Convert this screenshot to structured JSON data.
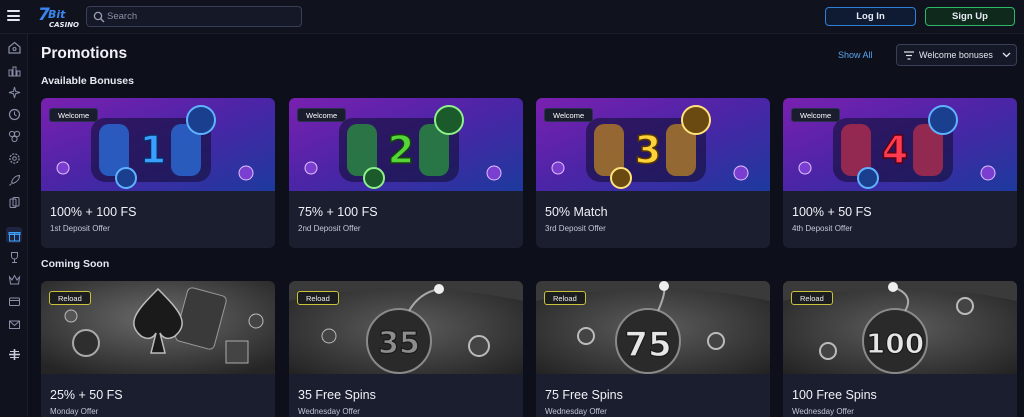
{
  "header": {
    "search_placeholder": "Search",
    "login_label": "Log In",
    "signup_label": "Sign Up",
    "logo_text": "7Bit CASINO"
  },
  "sidebar": {
    "items": [
      {
        "icon": "home-icon"
      },
      {
        "icon": "trophy-stats-icon"
      },
      {
        "icon": "sparkle-icon"
      },
      {
        "icon": "clock-icon"
      },
      {
        "icon": "dice-icon"
      },
      {
        "icon": "settings-icon"
      },
      {
        "icon": "rocket-icon"
      },
      {
        "icon": "cards-icon"
      },
      {
        "icon": "gift-icon",
        "active": true
      },
      {
        "icon": "trophy-icon"
      },
      {
        "icon": "crown-icon"
      },
      {
        "icon": "wallet-icon"
      },
      {
        "icon": "mail-icon"
      },
      {
        "icon": "support-icon"
      }
    ]
  },
  "main": {
    "title": "Promotions",
    "show_all": "Show All",
    "filter_label": "Welcome bonuses",
    "available_heading": "Available Bonuses",
    "coming_heading": "Coming Soon",
    "available": [
      {
        "badge": "Welcome",
        "number": "1",
        "num_color": "#3aa0ff",
        "title": "100% + 100 FS",
        "subtitle": "1st Deposit Offer"
      },
      {
        "badge": "Welcome",
        "number": "2",
        "num_color": "#56d53b",
        "title": "75% + 100 FS",
        "subtitle": "2nd Deposit Offer"
      },
      {
        "badge": "Welcome",
        "number": "3",
        "num_color": "#ffd23a",
        "title": "50% Match",
        "subtitle": "3rd Deposit Offer"
      },
      {
        "badge": "Welcome",
        "number": "4",
        "num_color": "#ff3b52",
        "title": "100% + 50 FS",
        "subtitle": "4th Deposit Offer"
      }
    ],
    "coming": [
      {
        "badge": "Reload",
        "art": "spade",
        "number": "",
        "title": "25% + 50 FS",
        "subtitle": "Monday Offer"
      },
      {
        "badge": "Reload",
        "art": "bomb",
        "number": "35",
        "title": "35 Free Spins",
        "subtitle": "Wednesday Offer"
      },
      {
        "badge": "Reload",
        "art": "bomb",
        "number": "75",
        "title": "75 Free Spins",
        "subtitle": "Wednesday Offer"
      },
      {
        "badge": "Reload",
        "art": "bomb",
        "number": "100",
        "title": "100 Free Spins",
        "subtitle": "Wednesday Offer"
      }
    ]
  },
  "colors": {
    "accent_blue": "#2d7fd8",
    "accent_green": "#2fb768",
    "reload_border": "#c9c23a",
    "welcome_bg_top": "#6a1fa8",
    "welcome_bg_bottom": "#2a1f8a"
  }
}
